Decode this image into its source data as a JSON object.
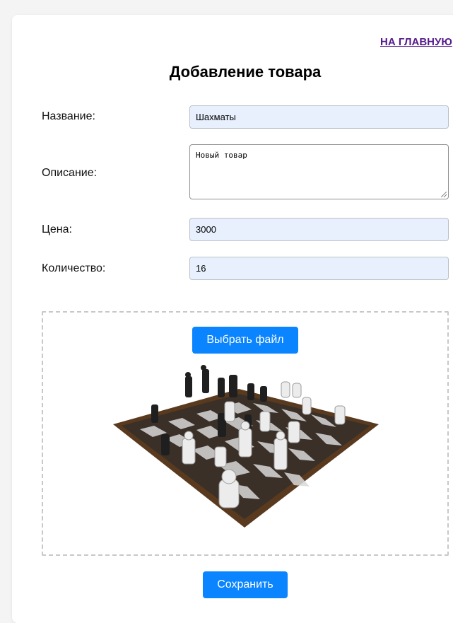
{
  "nav": {
    "home_link": "НА ГЛАВНУЮ"
  },
  "page_title": "Добавление товара",
  "form": {
    "name_label": "Название:",
    "name_value": "Шахматы",
    "description_label": "Описание:",
    "description_value": "Новый товар",
    "price_label": "Цена:",
    "price_value": "3000",
    "quantity_label": "Количество:",
    "quantity_value": "16"
  },
  "upload": {
    "choose_file_label": "Выбрать файл",
    "preview_icon": "chessboard-photo"
  },
  "actions": {
    "save_label": "Сохранить"
  },
  "colors": {
    "accent": "#0a84ff",
    "field_bg": "#e8f0fe",
    "link": "#551a8b"
  }
}
